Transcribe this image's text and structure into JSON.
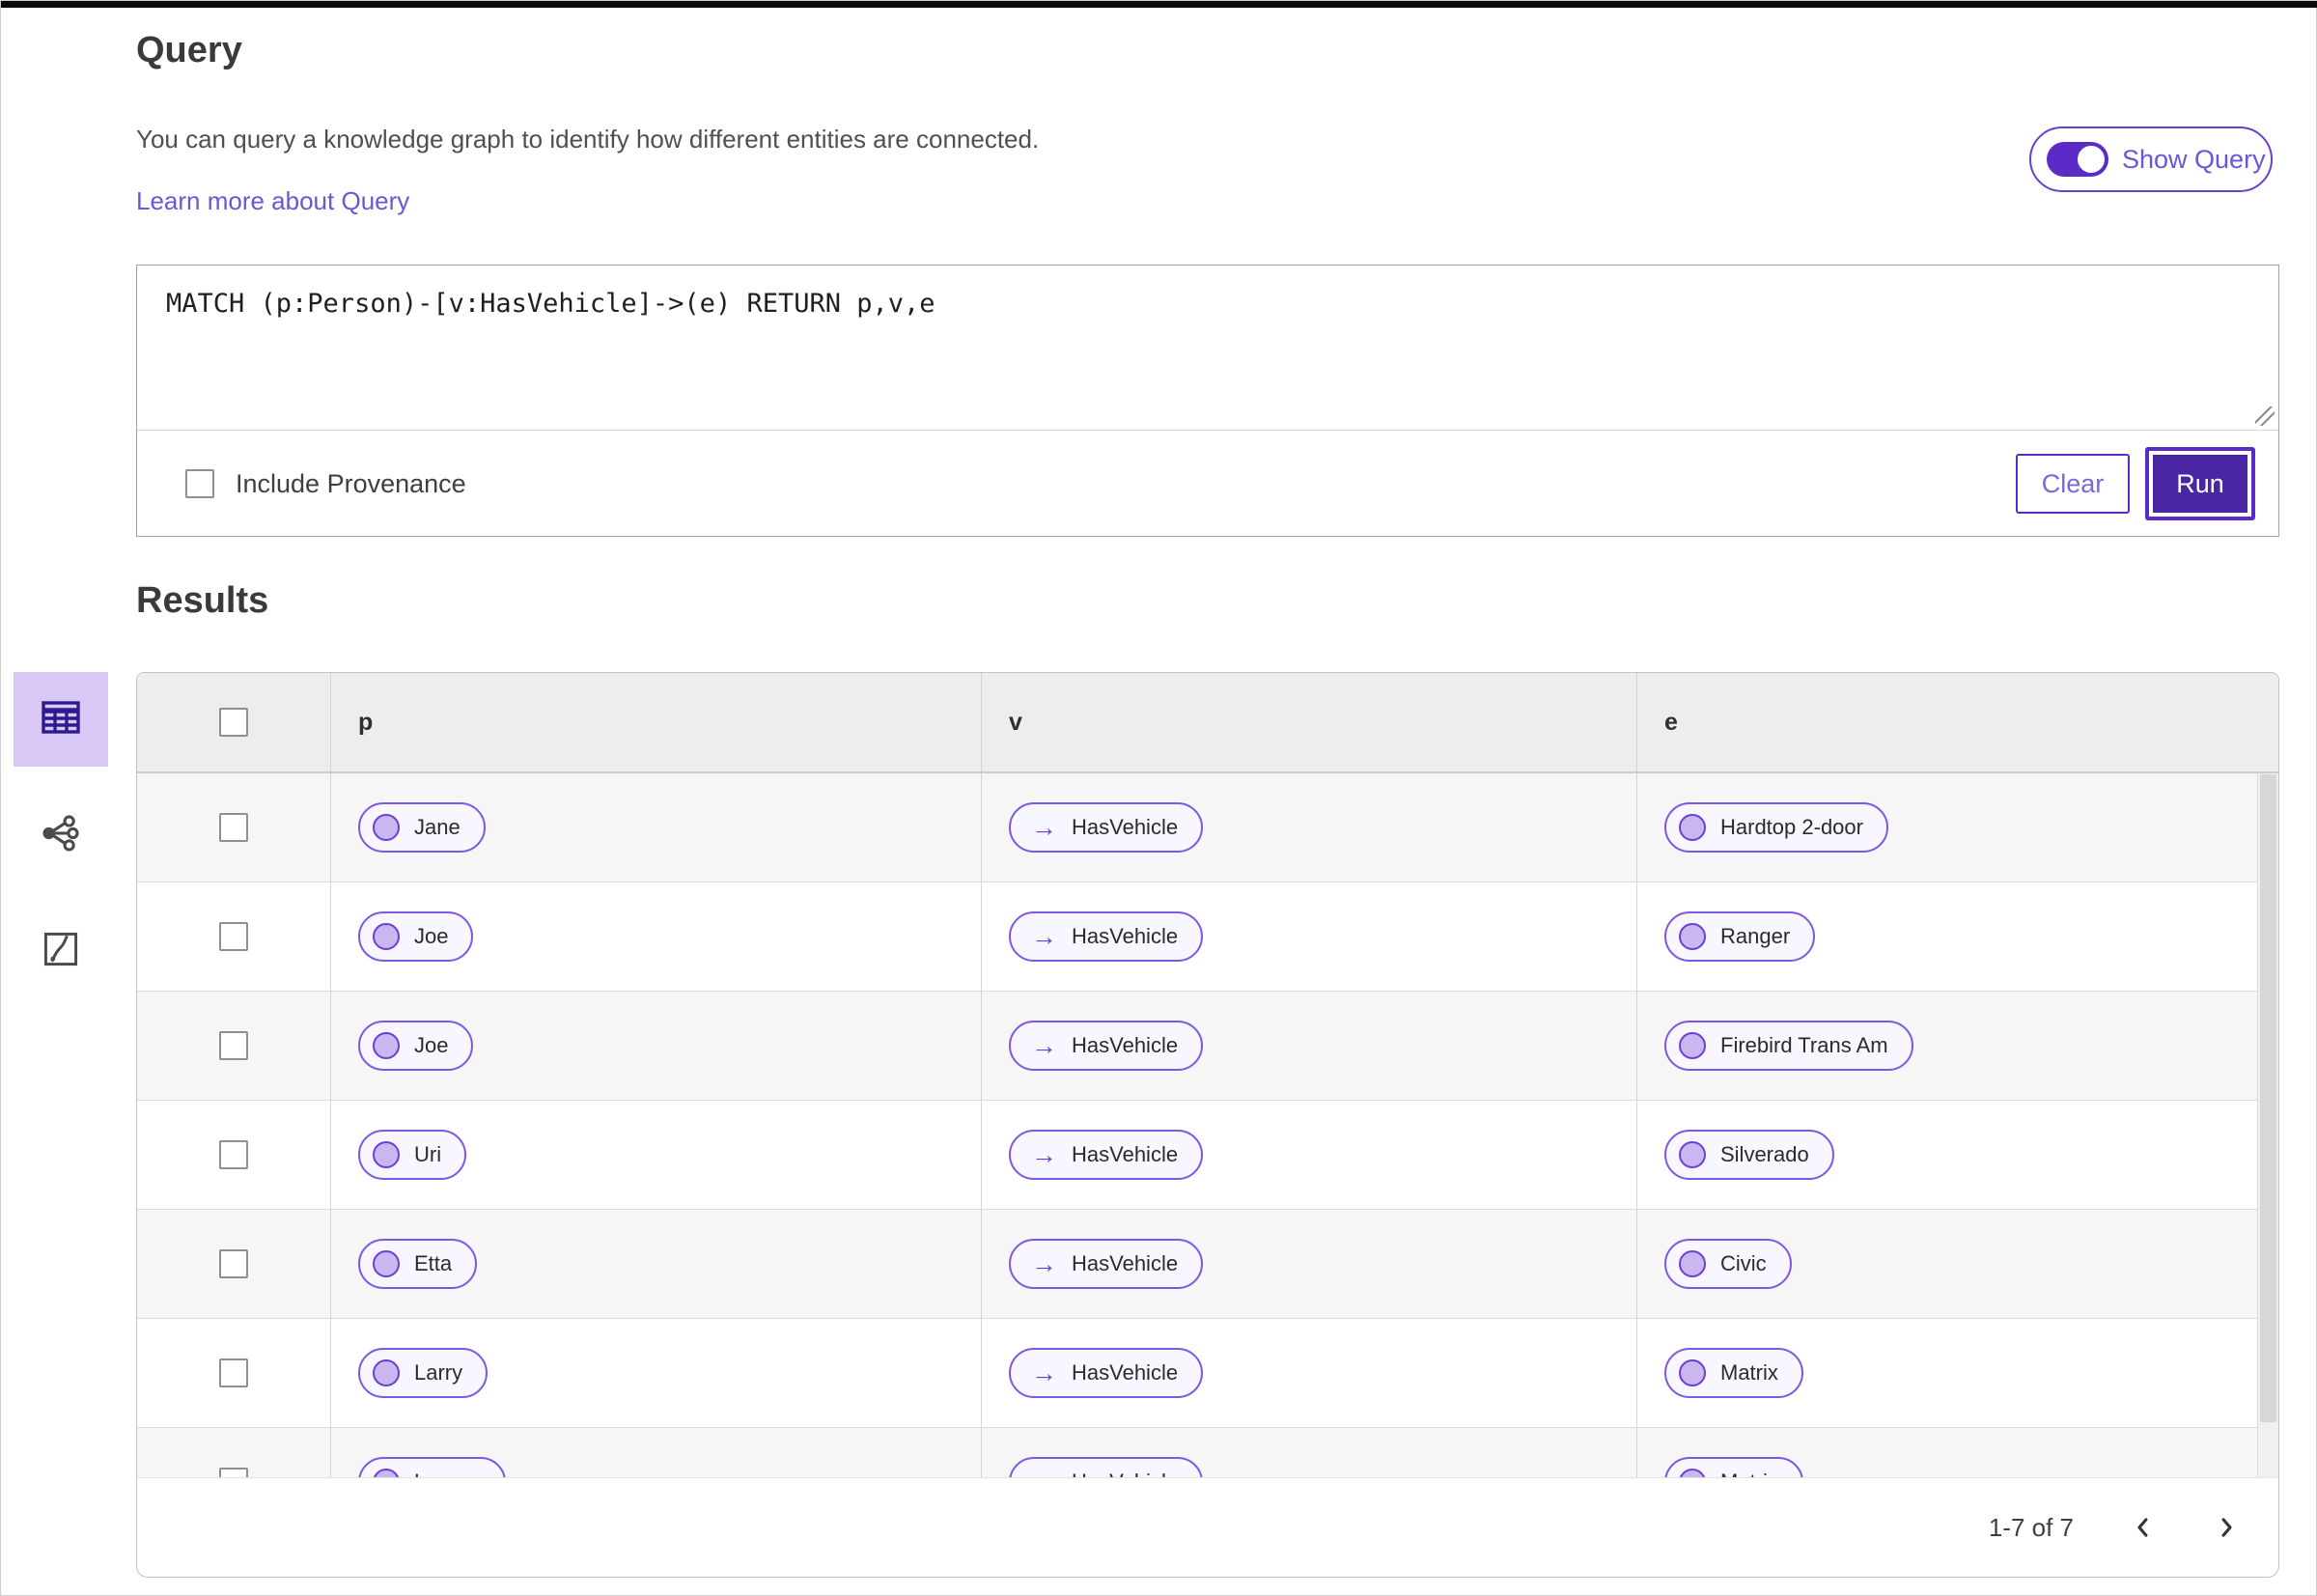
{
  "header": {
    "title": "Query",
    "description": "You can query a knowledge graph to identify how different entities are connected.",
    "learn_more": "Learn more about Query",
    "show_query_toggle": {
      "label": "Show Query",
      "on": true
    }
  },
  "query_editor": {
    "query_text": "MATCH (p:Person)-[v:HasVehicle]->(e) RETURN p,v,e",
    "include_provenance_label": "Include Provenance",
    "include_provenance_checked": false,
    "clear_button": "Clear",
    "run_button": "Run"
  },
  "results": {
    "title": "Results",
    "view_switcher": [
      {
        "name": "table-view",
        "icon": "table-icon",
        "selected": true
      },
      {
        "name": "graph-view",
        "icon": "graph-icon",
        "selected": false
      },
      {
        "name": "map-view",
        "icon": "map-icon",
        "selected": false
      }
    ],
    "table": {
      "columns": [
        "p",
        "v",
        "e"
      ],
      "edge_arrow": "→",
      "rows": [
        {
          "p": "Jane",
          "v": "HasVehicle",
          "e": "Hardtop 2-door"
        },
        {
          "p": "Joe",
          "v": "HasVehicle",
          "e": "Ranger"
        },
        {
          "p": "Joe",
          "v": "HasVehicle",
          "e": "Firebird Trans Am"
        },
        {
          "p": "Uri",
          "v": "HasVehicle",
          "e": "Silverado"
        },
        {
          "p": "Etta",
          "v": "HasVehicle",
          "e": "Civic"
        },
        {
          "p": "Larry",
          "v": "HasVehicle",
          "e": "Matrix"
        },
        {
          "p": "Lauren",
          "v": "HasVehicle",
          "e": "Matrix"
        }
      ]
    },
    "pagination": {
      "range_label": "1-7 of 7"
    }
  },
  "colors": {
    "accent_purple": "#5B2BC7",
    "run_fill": "#4B26A4",
    "pill_border": "#7E57E2",
    "pill_bg": "#F8F6FE",
    "node_circle_fill": "#CBB7F0",
    "link_purple": "#6C55D9",
    "selected_tile_bg": "#D9C8F5",
    "header_row_bg": "#EDEDED",
    "alt_row_bg": "#F6F6F6"
  }
}
